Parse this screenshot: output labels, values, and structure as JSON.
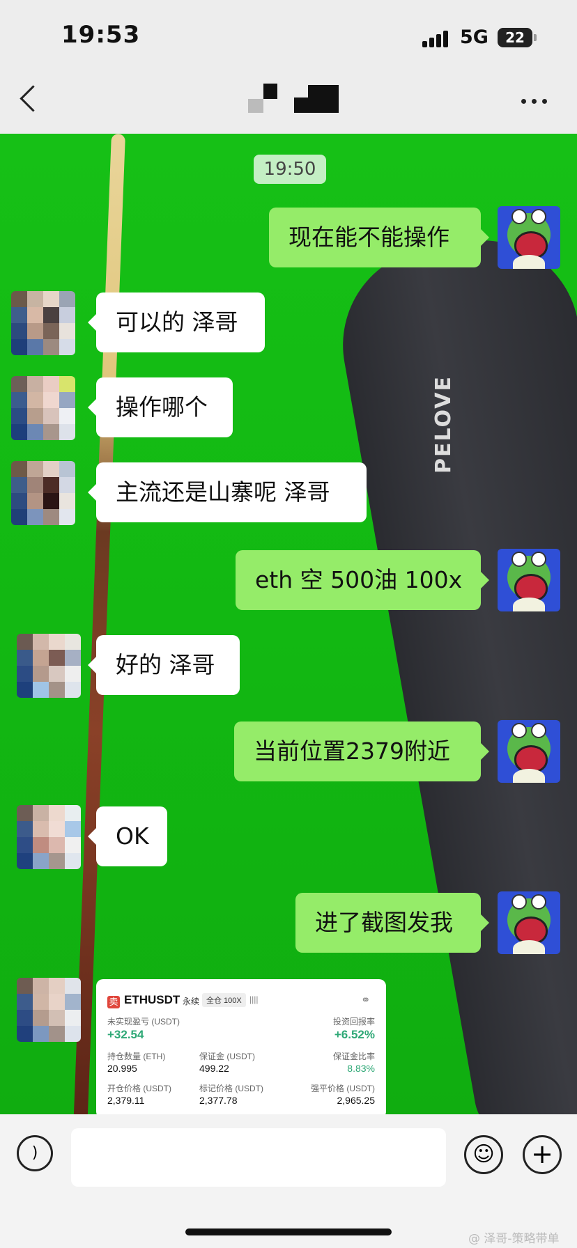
{
  "status_bar": {
    "time": "19:53",
    "network": "5G",
    "battery": "22"
  },
  "chat": {
    "timestamp": "19:50"
  },
  "messages": [
    {
      "side": "out",
      "text": "现在能不能操作"
    },
    {
      "side": "in",
      "text": "可以的 泽哥"
    },
    {
      "side": "in",
      "text": "操作哪个"
    },
    {
      "side": "in",
      "text": "主流还是山寨呢 泽哥"
    },
    {
      "side": "out",
      "text": "eth 空 500油 100x"
    },
    {
      "side": "in",
      "text": "好的 泽哥"
    },
    {
      "side": "out",
      "text": "当前位置2379附近"
    },
    {
      "side": "in",
      "text": "OK"
    },
    {
      "side": "out",
      "text": "进了截图发我"
    }
  ],
  "trade_card": {
    "sell_tag": "卖",
    "symbol": "ETHUSDT",
    "perp": "永续",
    "mode": "全仓 100X",
    "bars": "||||",
    "unrealized_pnl_label": "未实现盈亏 (USDT)",
    "unrealized_pnl": "+32.54",
    "roi_label": "投资回报率",
    "roi": "+6.52%",
    "position_label": "持仓数量 (ETH)",
    "position": "20.995",
    "margin_label": "保证金 (USDT)",
    "margin": "499.22",
    "margin_ratio_label": "保证金比率",
    "margin_ratio": "8.83%",
    "entry_label": "开仓价格 (USDT)",
    "entry": "2,379.11",
    "mark_label": "标记价格 (USDT)",
    "mark": "2,377.78",
    "liq_label": "强平价格 (USDT)",
    "liq": "2,965.25"
  },
  "background": {
    "case_logo": "PELOVE"
  },
  "input_bar": {
    "placeholder": ""
  },
  "watermark": "@ 泽哥-策略带单",
  "icons": {
    "back": "chevron-left-icon",
    "more": "more-icon",
    "voice": "voice-icon",
    "emoji": "emoji-icon",
    "plus": "plus-icon",
    "share": "share-icon"
  },
  "colors": {
    "outgoing_bubble": "#95ec69",
    "incoming_bubble": "#ffffff",
    "profit_green": "#2ea876",
    "sell_red": "#e0463c"
  }
}
